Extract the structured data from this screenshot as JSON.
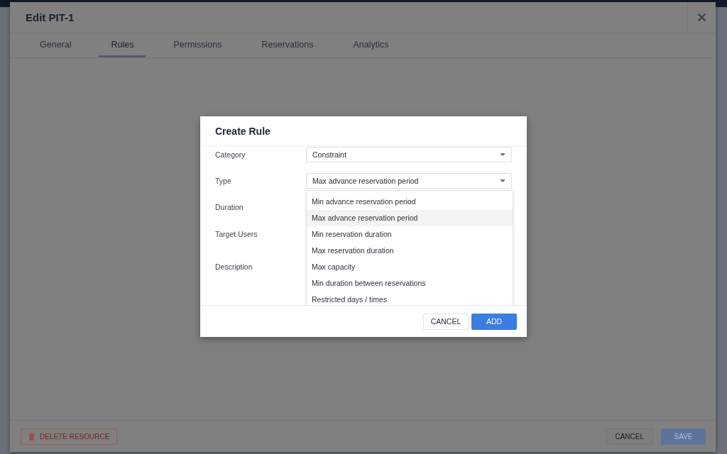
{
  "window": {
    "title": "Edit PIT-1",
    "close": "✕"
  },
  "tabs": [
    {
      "label": "General",
      "selected": false
    },
    {
      "label": "Rules",
      "selected": true
    },
    {
      "label": "Permissions",
      "selected": false
    },
    {
      "label": "Reservations",
      "selected": false
    },
    {
      "label": "Analytics",
      "selected": false
    }
  ],
  "dialog": {
    "title": "Create Rule",
    "fields": [
      {
        "label": "Category",
        "kind": "select",
        "value": "Constraint"
      },
      {
        "label": "Type",
        "kind": "select",
        "value": "Max advance reservation period",
        "menu": [
          {
            "label": "Min advance reservation period",
            "selected": false
          },
          {
            "label": "Max advance reservation period",
            "selected": true
          },
          {
            "label": "Min reservation duration",
            "selected": false
          },
          {
            "label": "Max reservation duration",
            "selected": false
          },
          {
            "label": "Max capacity",
            "selected": false
          },
          {
            "label": "Min duration between reservations",
            "selected": false
          },
          {
            "label": "Restricted days / times",
            "selected": false
          }
        ]
      },
      {
        "label": "Duration",
        "kind": "hidden"
      },
      {
        "label": "Target Users",
        "kind": "hidden"
      },
      {
        "label": "Description",
        "kind": "hidden"
      }
    ],
    "buttons": [
      {
        "label": "CANCEL",
        "kind": "secondary"
      },
      {
        "label": "ADD",
        "kind": "primary"
      }
    ]
  },
  "footer": {
    "delete": "DELETE RESOURCE",
    "buttons": [
      {
        "label": "CANCEL",
        "kind": "secondary"
      },
      {
        "label": "SAVE",
        "kind": "primary"
      }
    ]
  }
}
